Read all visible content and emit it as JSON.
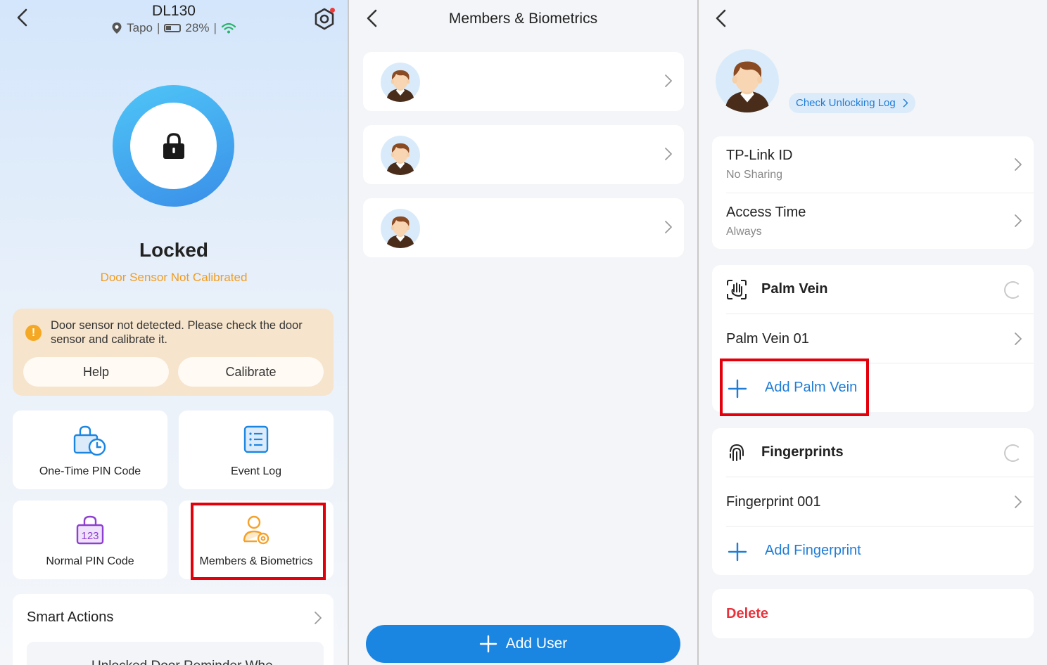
{
  "colors": {
    "accent": "#1b86e2",
    "warning": "#f29c1f",
    "danger": "#e8323c",
    "highlight": "#e3000b",
    "link": "#1f7dd6"
  },
  "home": {
    "device_name": "DL130",
    "brand": "Tapo",
    "battery": "28%",
    "separator": "|",
    "icons": [
      "back-arrow-icon",
      "location-pin-icon",
      "battery-icon",
      "wifi-icon",
      "settings-hex-icon",
      "lock-icon"
    ],
    "lock_status": "Locked",
    "sensor_status": "Door Sensor Not Calibrated",
    "warning": {
      "icon": "!",
      "message": "Door sensor not detected. Please check the door sensor and calibrate it.",
      "help_label": "Help",
      "calibrate_label": "Calibrate"
    },
    "tiles": [
      {
        "label": "One-Time PIN Code",
        "icon": "lock-clock-icon"
      },
      {
        "label": "Event Log",
        "icon": "list-icon"
      },
      {
        "label": "Normal PIN Code",
        "icon": "pin-123-icon"
      },
      {
        "label": "Members & Biometrics",
        "icon": "person-gear-icon"
      }
    ],
    "pin_digits": "123",
    "smart_actions": {
      "title": "Smart Actions",
      "reminder": "Unlocked Door Reminder Whe..."
    }
  },
  "members": {
    "title": "Members & Biometrics",
    "count_members": 3,
    "add_user_label": "Add User"
  },
  "member_detail": {
    "unlock_log_label": "Check Unlocking Log",
    "tplink": {
      "title": "TP-Link ID",
      "value": "No Sharing"
    },
    "access": {
      "title": "Access Time",
      "value": "Always"
    },
    "palm_vein": {
      "section": "Palm Vein",
      "item": "Palm Vein 01",
      "add_label": "Add Palm Vein"
    },
    "fingerprints": {
      "section": "Fingerprints",
      "item": "Fingerprint 001",
      "add_label": "Add Fingerprint"
    },
    "delete_label": "Delete"
  }
}
